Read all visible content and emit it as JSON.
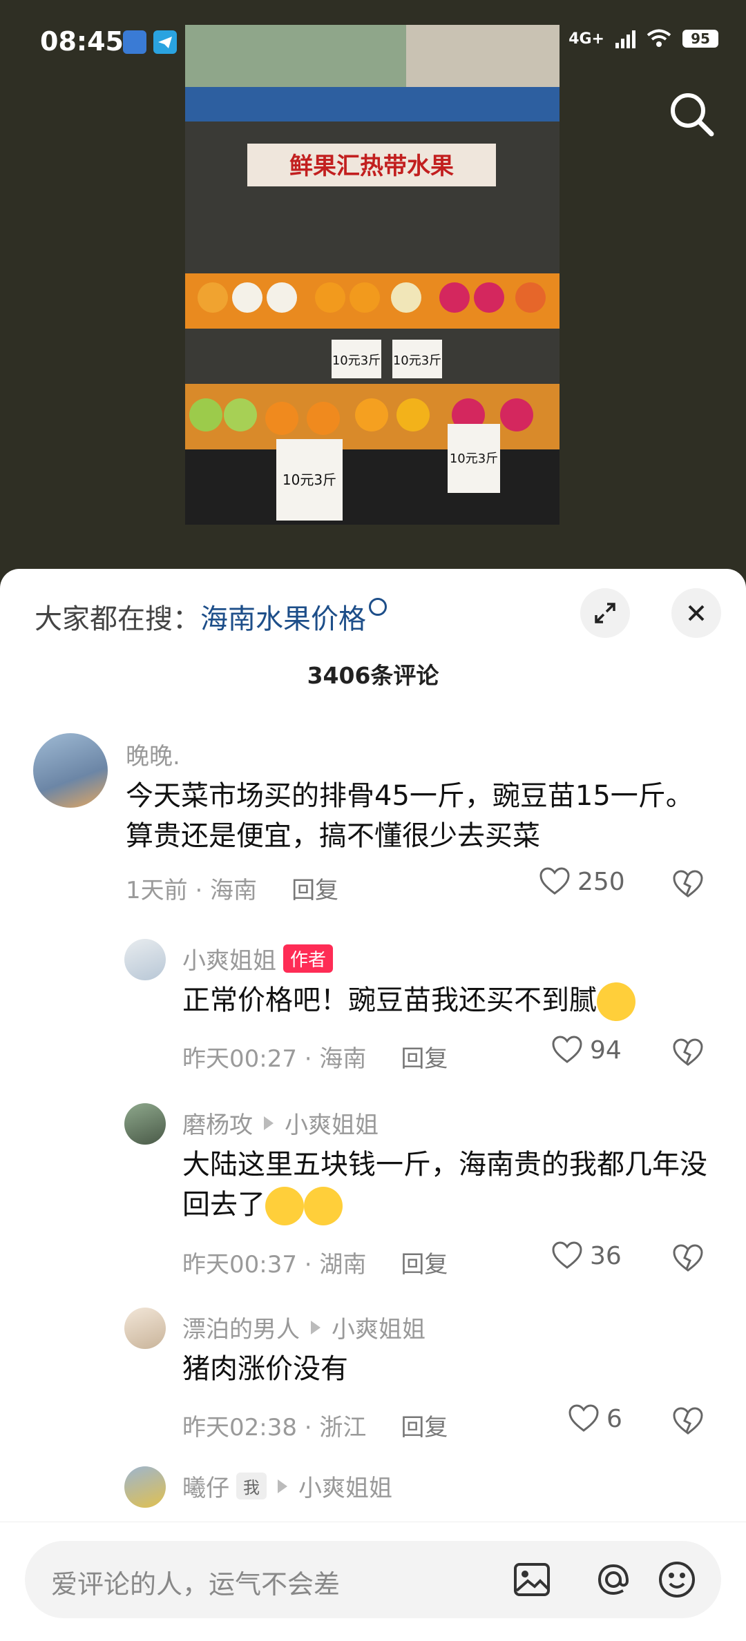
{
  "status_bar": {
    "time": "08:45",
    "network1": "4G",
    "network2": "4G+",
    "battery": "95"
  },
  "hot_search": {
    "prefix": "大家都在搜：",
    "keyword": "海南水果价格"
  },
  "comment_count": "3406条评论",
  "comments": [
    {
      "user": "晚晚.",
      "text": "今天菜市场买的排骨45一斤，豌豆苗15一斤。算贵还是便宜，搞不懂很少去买菜",
      "time": "1天前 · 海南",
      "reply": "回复",
      "likes": "250"
    },
    {
      "user": "小爽姐姐",
      "tag": "作者",
      "text": "正常价格吧！豌豆苗我还买不到腻",
      "time": "昨天00:27 · 海南",
      "reply": "回复",
      "likes": "94"
    },
    {
      "user": "磨杨攻",
      "reply_to": "小爽姐姐",
      "text": "大陆这里五块钱一斤，海南贵的我都几年没回去了",
      "time": "昨天00:37 · 湖南",
      "reply": "回复",
      "likes": "36"
    },
    {
      "user": "漂泊的男人",
      "reply_to": "小爽姐姐",
      "text": "猪肉涨价没有",
      "time": "昨天02:38 · 浙江",
      "reply": "回复",
      "likes": "6"
    },
    {
      "user": "曦仔",
      "tag": "我",
      "reply_to": "小爽姐姐"
    }
  ],
  "input": {
    "placeholder": "爱评论的人，运气不会差"
  },
  "photo": {
    "sign": "鲜果汇热带水果",
    "price_tags": [
      "10元3斤",
      "10元3斤",
      "10元3斤",
      "10元3斤"
    ]
  }
}
